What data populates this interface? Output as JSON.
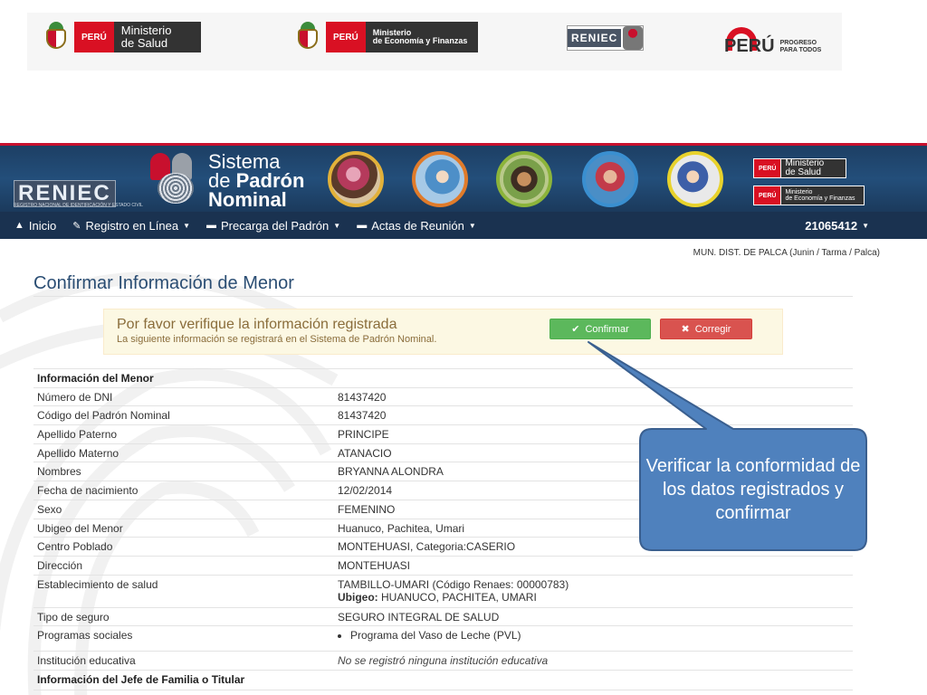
{
  "logos": {
    "salud": {
      "peru": "PERÚ",
      "line1": "Ministerio",
      "line2": "de Salud"
    },
    "mef": {
      "peru": "PERÚ",
      "line1": "Ministerio",
      "line2": "de Economía y Finanzas"
    },
    "reniec": {
      "text": "RENIEC"
    },
    "peru_brand": {
      "word": "PERÚ",
      "tag1": "PROGRESO",
      "tag2": "PARA TODOS"
    }
  },
  "banner": {
    "reniec_word": "RENIEC",
    "reniec_sub": "REGISTRO NACIONAL DE IDENTIFICACIÓN Y ESTADO CIVIL",
    "title_l1": "Sistema",
    "title_l2a": "de ",
    "title_l2b": "Padrón",
    "title_l3": "Nominal",
    "min1_peru": "PERÚ",
    "min1_l1": "Ministerio",
    "min1_l2": "de Salud",
    "min2_peru": "PERÚ",
    "min2_l1": "Ministerio",
    "min2_l2": "de Economía y Finanzas"
  },
  "nav": {
    "items": [
      {
        "label": "Inicio",
        "icon": "home-icon",
        "glyph": "🏠",
        "caret": false
      },
      {
        "label": "Registro en Línea",
        "icon": "pencil-icon",
        "glyph": "✎",
        "caret": true
      },
      {
        "label": "Precarga del Padrón",
        "icon": "upload-icon",
        "glyph": "▬",
        "caret": true
      },
      {
        "label": "Actas de Reunión",
        "icon": "folder-icon",
        "glyph": "▰",
        "caret": true
      }
    ],
    "user": "21065412"
  },
  "location": "MUN. DIST. DE PALCA (Junin / Tarma / Palca)",
  "page_title": "Confirmar Información de Menor",
  "alert": {
    "heading": "Por favor verifique la información registrada",
    "subtext": "La siguiente información se registrará en el Sistema de Padrón Nominal.",
    "confirm_label": "Confirmar",
    "correct_label": "Corregir"
  },
  "info": {
    "section1": "Información del Menor",
    "rows": [
      {
        "label": "Número de DNI",
        "value": "81437420"
      },
      {
        "label": "Código del Padrón Nominal",
        "value": "81437420"
      },
      {
        "label": "Apellido Paterno",
        "value": "PRINCIPE"
      },
      {
        "label": "Apellido Materno",
        "value": "ATANACIO"
      },
      {
        "label": "Nombres",
        "value": "BRYANNA ALONDRA"
      },
      {
        "label": "Fecha de nacimiento",
        "value": "12/02/2014"
      },
      {
        "label": "Sexo",
        "value": "FEMENINO"
      },
      {
        "label": "Ubigeo del Menor",
        "value": "Huanuco, Pachitea, Umari"
      },
      {
        "label": "Centro Poblado",
        "value": "MONTEHUASI, Categoria:CASERIO"
      },
      {
        "label": "Dirección",
        "value": "MONTEHUASI"
      }
    ],
    "establecimiento_label": "Establecimiento de salud",
    "establecimiento_value": "TAMBILLO-UMARI (Código Renaes: 00000783)",
    "ubigeo_label": "Ubigeo:",
    "ubigeo_value": " HUANUCO, PACHITEA, UMARI",
    "seguro_label": "Tipo de seguro",
    "seguro_value": "SEGURO INTEGRAL DE SALUD",
    "programas_label": "Programas sociales",
    "programas_value": "Programa del Vaso de Leche (PVL)",
    "institucion_label": "Institución educativa",
    "institucion_value": "No se registró ninguna institución educativa",
    "section2": "Información del Jefe de Familia o Titular"
  },
  "callout": {
    "text": "Verificar la conformidad de los datos registrados y confirmar"
  },
  "colors": {
    "banner": "#234e7a",
    "navbar": "#1a3250",
    "title": "#2a4d73",
    "alert_bg": "#fcf8e3",
    "confirm": "#5cb85c",
    "correct": "#d9534f",
    "callout_fill": "#4f81bd",
    "callout_border": "#3a5f8f"
  }
}
